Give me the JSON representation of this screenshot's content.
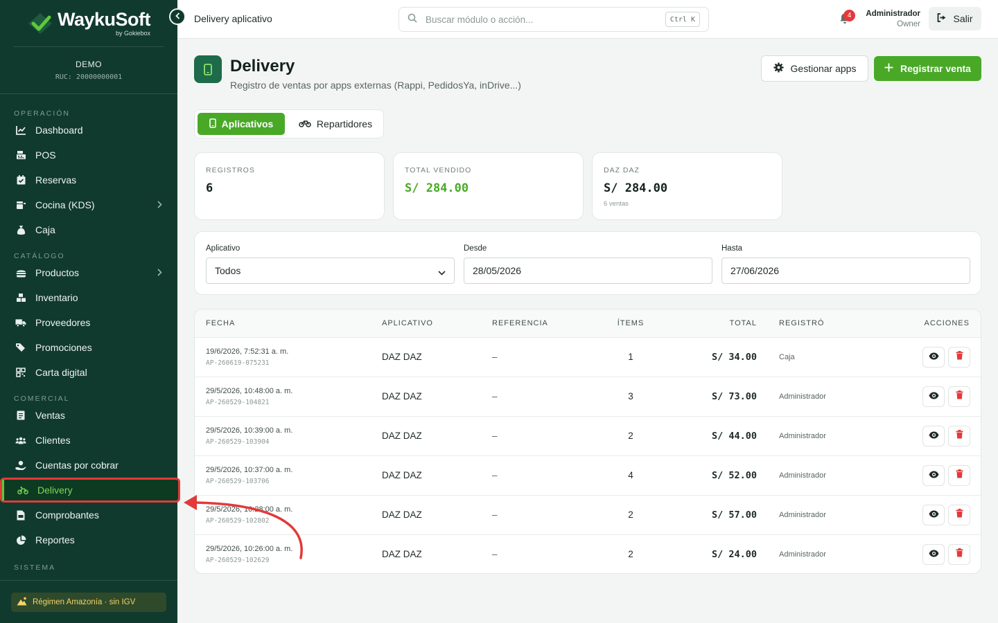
{
  "brand": {
    "name": "WaykuSoft",
    "by": "by Gokiebox"
  },
  "company": {
    "name": "DEMO",
    "ruc": "RUC: 20000000001"
  },
  "nav": {
    "sections": [
      "OPERACIÓN",
      "CATÁLOGO",
      "COMERCIAL",
      "SISTEMA"
    ],
    "items": [
      {
        "label": "Dashboard",
        "icon": "chart-line-icon"
      },
      {
        "label": "POS",
        "icon": "cash-register-icon"
      },
      {
        "label": "Reservas",
        "icon": "calendar-check-icon"
      },
      {
        "label": "Cocina (KDS)",
        "icon": "kitchen-icon"
      },
      {
        "label": "Caja",
        "icon": "money-bag-icon"
      },
      {
        "label": "Productos",
        "icon": "burger-icon"
      },
      {
        "label": "Inventario",
        "icon": "boxes-icon"
      },
      {
        "label": "Proveedores",
        "icon": "truck-icon"
      },
      {
        "label": "Promociones",
        "icon": "tags-icon"
      },
      {
        "label": "Carta digital",
        "icon": "qrcode-icon"
      },
      {
        "label": "Ventas",
        "icon": "receipt-icon"
      },
      {
        "label": "Clientes",
        "icon": "users-icon"
      },
      {
        "label": "Cuentas por cobrar",
        "icon": "hand-coin-icon"
      },
      {
        "label": "Delivery",
        "icon": "motorcycle-icon"
      },
      {
        "label": "Comprobantes",
        "icon": "file-invoice-icon"
      },
      {
        "label": "Reportes",
        "icon": "pie-chart-icon"
      }
    ],
    "regime": "Régimen Amazonía · sin IGV"
  },
  "topbar": {
    "title": "Delivery aplicativo",
    "search_placeholder": "Buscar módulo o acción...",
    "shortcut": "Ctrl K",
    "notifications": "4",
    "user_name": "Administrador",
    "user_role": "Owner",
    "logout": "Salir"
  },
  "page": {
    "title": "Delivery",
    "subtitle": "Registro de ventas por apps externas (Rappi, PedidosYa, inDrive...)",
    "manage_apps": "Gestionar apps",
    "register_sale": "Registrar venta"
  },
  "tabs": [
    "Aplicativos",
    "Repartidores"
  ],
  "stats": [
    {
      "label": "REGISTROS",
      "value": "6",
      "note": ""
    },
    {
      "label": "TOTAL VENDIDO",
      "value": "S/ 284.00",
      "note": ""
    },
    {
      "label": "DAZ DAZ",
      "value": "S/ 284.00",
      "note": "6 ventas"
    }
  ],
  "filters": {
    "app_label": "Aplicativo",
    "app_value": "Todos",
    "from_label": "Desde",
    "from_value": "28/05/2026",
    "to_label": "Hasta",
    "to_value": "27/06/2026"
  },
  "table": {
    "headers": [
      "FECHA",
      "APLICATIVO",
      "REFERENCIA",
      "ÍTEMS",
      "TOTAL",
      "REGISTRÓ",
      "ACCIONES"
    ],
    "rows": [
      {
        "date": "19/6/2026, 7:52:31 a. m.",
        "code": "AP-260619-075231",
        "app": "DAZ DAZ",
        "ref": "–",
        "items": "1",
        "total": "S/ 34.00",
        "by": "Caja"
      },
      {
        "date": "29/5/2026, 10:48:00 a. m.",
        "code": "AP-260529-104821",
        "app": "DAZ DAZ",
        "ref": "–",
        "items": "3",
        "total": "S/ 73.00",
        "by": "Administrador"
      },
      {
        "date": "29/5/2026, 10:39:00 a. m.",
        "code": "AP-260529-103904",
        "app": "DAZ DAZ",
        "ref": "–",
        "items": "2",
        "total": "S/ 44.00",
        "by": "Administrador"
      },
      {
        "date": "29/5/2026, 10:37:00 a. m.",
        "code": "AP-260529-103706",
        "app": "DAZ DAZ",
        "ref": "–",
        "items": "4",
        "total": "S/ 52.00",
        "by": "Administrador"
      },
      {
        "date": "29/5/2026, 10:28:00 a. m.",
        "code": "AP-260529-102802",
        "app": "DAZ DAZ",
        "ref": "–",
        "items": "2",
        "total": "S/ 57.00",
        "by": "Administrador"
      },
      {
        "date": "29/5/2026, 10:26:00 a. m.",
        "code": "AP-260529-102629",
        "app": "DAZ DAZ",
        "ref": "–",
        "items": "2",
        "total": "S/ 24.00",
        "by": "Administrador"
      }
    ]
  },
  "colors": {
    "sidebar": "#113a2e",
    "accent": "#49a927",
    "active_text": "#7fd857",
    "danger": "#e5393a",
    "annotation": "#e23a3a"
  }
}
